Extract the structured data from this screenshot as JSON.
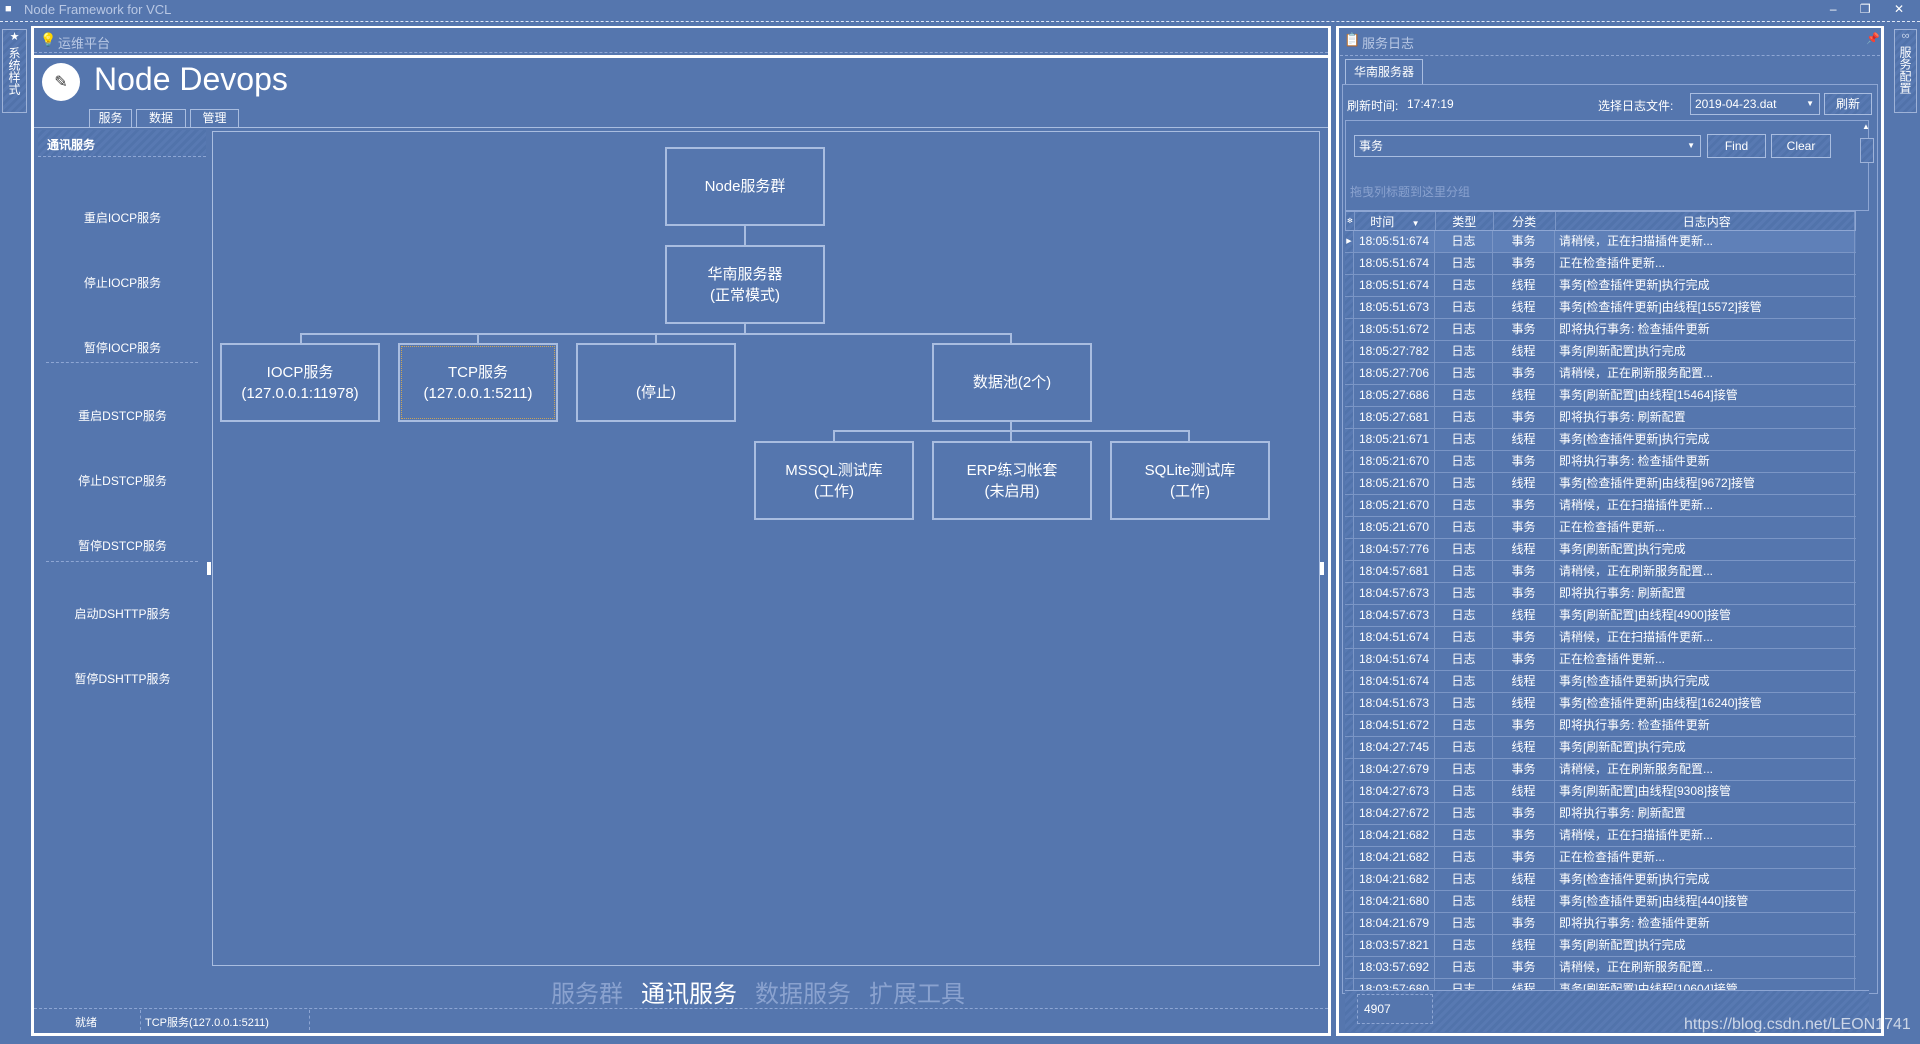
{
  "app_title": "Node Framework for VCL",
  "left_strip_label": "系统样式",
  "right_strip_label": "服务配置",
  "main": {
    "panel_title": "运维平台",
    "brand": "Node Devops",
    "tabs": [
      "服务",
      "数据",
      "管理"
    ],
    "sidebar": {
      "header": "通讯服务",
      "items": [
        "重启IOCP服务",
        "停止IOCP服务",
        "暂停IOCP服务",
        "重启DSTCP服务",
        "停止DSTCP服务",
        "暂停DSTCP服务",
        "启动DSHTTP服务",
        "暂停DSHTTP服务"
      ]
    },
    "diagram": {
      "root": "Node服务群",
      "server": [
        "华南服务器",
        "(正常模式)"
      ],
      "iocp": [
        "IOCP服务",
        "(127.0.0.1:11978)"
      ],
      "tcp": [
        "TCP服务",
        "(127.0.0.1:5211)"
      ],
      "stopped": "(停止)",
      "pool": "数据池(2个)",
      "mssql": [
        "MSSQL测试库",
        "(工作)"
      ],
      "erp": [
        "ERP练习帐套",
        "(未启用)"
      ],
      "sqlite": [
        "SQLite测试库",
        "(工作)"
      ]
    },
    "bottom_tabs": [
      {
        "label": "服务群",
        "active": false
      },
      {
        "label": "通讯服务",
        "active": true
      },
      {
        "label": "数据服务",
        "active": false
      },
      {
        "label": "扩展工具",
        "active": false
      }
    ],
    "status": {
      "state": "就绪",
      "service": "TCP服务(127.0.0.1:5211)"
    }
  },
  "log": {
    "panel_title": "服务日志",
    "tab": "华南服务器",
    "refresh_time_label": "刷新时间:",
    "refresh_time": "17:47:19",
    "file_label": "选择日志文件:",
    "file_value": "2019-04-23.dat",
    "refresh_button": "刷新",
    "filter_value": "事务",
    "find_button": "Find",
    "clear_button": "Clear",
    "group_hint": "拖曳列标题到这里分组",
    "columns": [
      "时间",
      "类型",
      "分类",
      "日志内容"
    ],
    "rows": [
      [
        "18:05:51:674",
        "日志",
        "事务",
        "请稍候，正在扫描插件更新..."
      ],
      [
        "18:05:51:674",
        "日志",
        "事务",
        "正在检查插件更新..."
      ],
      [
        "18:05:51:674",
        "日志",
        "线程",
        "事务[检查插件更新]执行完成"
      ],
      [
        "18:05:51:673",
        "日志",
        "线程",
        "事务[检查插件更新]由线程[15572]接管"
      ],
      [
        "18:05:51:672",
        "日志",
        "事务",
        "即将执行事务: 检查插件更新"
      ],
      [
        "18:05:27:782",
        "日志",
        "线程",
        "事务[刷新配置]执行完成"
      ],
      [
        "18:05:27:706",
        "日志",
        "事务",
        "请稍候，正在刷新服务配置..."
      ],
      [
        "18:05:27:686",
        "日志",
        "线程",
        "事务[刷新配置]由线程[15464]接管"
      ],
      [
        "18:05:27:681",
        "日志",
        "事务",
        "即将执行事务: 刷新配置"
      ],
      [
        "18:05:21:671",
        "日志",
        "线程",
        "事务[检查插件更新]执行完成"
      ],
      [
        "18:05:21:670",
        "日志",
        "事务",
        "即将执行事务: 检查插件更新"
      ],
      [
        "18:05:21:670",
        "日志",
        "线程",
        "事务[检查插件更新]由线程[9672]接管"
      ],
      [
        "18:05:21:670",
        "日志",
        "事务",
        "请稍候，正在扫描插件更新..."
      ],
      [
        "18:05:21:670",
        "日志",
        "事务",
        "正在检查插件更新..."
      ],
      [
        "18:04:57:776",
        "日志",
        "线程",
        "事务[刷新配置]执行完成"
      ],
      [
        "18:04:57:681",
        "日志",
        "事务",
        "请稍候，正在刷新服务配置..."
      ],
      [
        "18:04:57:673",
        "日志",
        "事务",
        "即将执行事务: 刷新配置"
      ],
      [
        "18:04:57:673",
        "日志",
        "线程",
        "事务[刷新配置]由线程[4900]接管"
      ],
      [
        "18:04:51:674",
        "日志",
        "事务",
        "请稍候，正在扫描插件更新..."
      ],
      [
        "18:04:51:674",
        "日志",
        "事务",
        "正在检查插件更新..."
      ],
      [
        "18:04:51:674",
        "日志",
        "线程",
        "事务[检查插件更新]执行完成"
      ],
      [
        "18:04:51:673",
        "日志",
        "线程",
        "事务[检查插件更新]由线程[16240]接管"
      ],
      [
        "18:04:51:672",
        "日志",
        "事务",
        "即将执行事务: 检查插件更新"
      ],
      [
        "18:04:27:745",
        "日志",
        "线程",
        "事务[刷新配置]执行完成"
      ],
      [
        "18:04:27:679",
        "日志",
        "事务",
        "请稍候，正在刷新服务配置..."
      ],
      [
        "18:04:27:673",
        "日志",
        "线程",
        "事务[刷新配置]由线程[9308]接管"
      ],
      [
        "18:04:27:672",
        "日志",
        "事务",
        "即将执行事务: 刷新配置"
      ],
      [
        "18:04:21:682",
        "日志",
        "事务",
        "请稍候，正在扫描插件更新..."
      ],
      [
        "18:04:21:682",
        "日志",
        "事务",
        "正在检查插件更新..."
      ],
      [
        "18:04:21:682",
        "日志",
        "线程",
        "事务[检查插件更新]执行完成"
      ],
      [
        "18:04:21:680",
        "日志",
        "线程",
        "事务[检查插件更新]由线程[440]接管"
      ],
      [
        "18:04:21:679",
        "日志",
        "事务",
        "即将执行事务: 检查插件更新"
      ],
      [
        "18:03:57:821",
        "日志",
        "线程",
        "事务[刷新配置]执行完成"
      ],
      [
        "18:03:57:692",
        "日志",
        "事务",
        "请稍候，正在刷新服务配置..."
      ],
      [
        "18:03:57:680",
        "日志",
        "线程",
        "事务[刷新配置]由线程[10604]接管"
      ]
    ],
    "record_count": "4907"
  },
  "watermark": "https://blog.csdn.net/LEON1741",
  "colors": {
    "background": "#5576ae",
    "border": "#a9bde0",
    "text": "#ffffff"
  }
}
